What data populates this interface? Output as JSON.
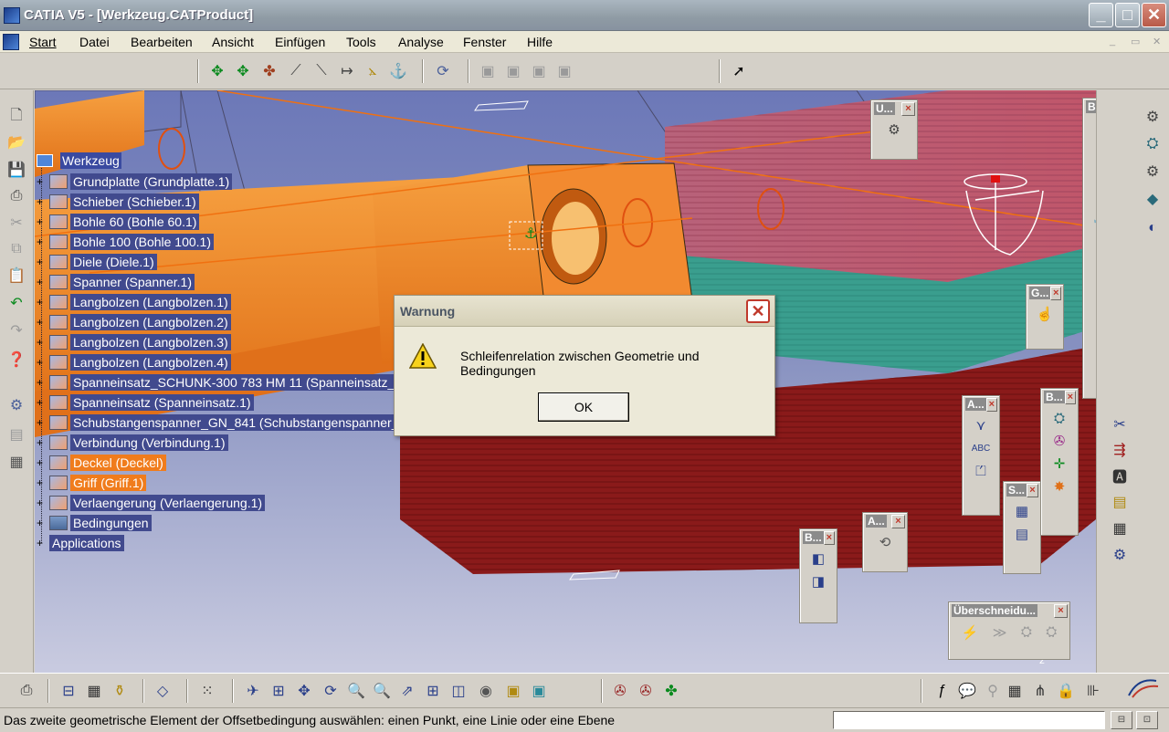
{
  "window": {
    "title": "CATIA V5 - [Werkzeug.CATProduct]",
    "minimize": "_",
    "maximize": "□",
    "close": "✕"
  },
  "menu": {
    "items": [
      {
        "label": "Start"
      },
      {
        "label": "Datei"
      },
      {
        "label": "Bearbeiten"
      },
      {
        "label": "Ansicht"
      },
      {
        "label": "Einfügen"
      },
      {
        "label": "Tools"
      },
      {
        "label": "Analyse"
      },
      {
        "label": "Fenster"
      },
      {
        "label": "Hilfe"
      }
    ],
    "mdi_minimize": "_",
    "mdi_restore": "▭",
    "mdi_close": "✕"
  },
  "tree": {
    "root": "Werkzeug",
    "nodes": [
      {
        "label": "Grundplatte (Grundplatte.1)",
        "state": "normal"
      },
      {
        "label": "Schieber (Schieber.1)",
        "state": "normal"
      },
      {
        "label": "Bohle 60 (Bohle 60.1)",
        "state": "normal"
      },
      {
        "label": "Bohle 100 (Bohle 100.1)",
        "state": "normal"
      },
      {
        "label": "Diele (Diele.1)",
        "state": "normal"
      },
      {
        "label": "Spanner (Spanner.1)",
        "state": "normal"
      },
      {
        "label": "Langbolzen (Langbolzen.1)",
        "state": "normal"
      },
      {
        "label": "Langbolzen (Langbolzen.2)",
        "state": "normal"
      },
      {
        "label": "Langbolzen (Langbolzen.3)",
        "state": "normal"
      },
      {
        "label": "Langbolzen (Langbolzen.4)",
        "state": "normal"
      },
      {
        "label": "Spanneinsatz_SCHUNK-300 783 HM 11 (Spanneinsatz_S",
        "state": "normal"
      },
      {
        "label": "Spanneinsatz (Spanneinsatz.1)",
        "state": "normal"
      },
      {
        "label": "Schubstangenspanner_GN_841 (Schubstangenspanner_",
        "state": "normal"
      },
      {
        "label": "Verbindung (Verbindung.1)",
        "state": "normal"
      },
      {
        "label": "Deckel (Deckel)",
        "state": "selected"
      },
      {
        "label": "Griff (Griff.1)",
        "state": "selected"
      },
      {
        "label": "Verlaengerung (Verlaengerung.1)",
        "state": "normal"
      },
      {
        "label": "Bedingungen",
        "state": "normal"
      },
      {
        "label": "Applications",
        "state": "app"
      }
    ]
  },
  "palettes": {
    "u": {
      "title": "U...",
      "close": "×"
    },
    "b_right": {
      "title": "B...",
      "close": "×"
    },
    "g": {
      "title": "G...",
      "close": "×"
    },
    "a1": {
      "title": "A...",
      "close": "×"
    },
    "b2": {
      "title": "B...",
      "close": "×"
    },
    "s": {
      "title": "S...",
      "close": "×"
    },
    "a2": {
      "title": "A...",
      "close": "×"
    },
    "b3": {
      "title": "B...",
      "close": "×"
    },
    "ueber": {
      "title": "Überschneidu...",
      "close": "×"
    }
  },
  "dialog": {
    "title": "Warnung",
    "message": "Schleifenrelation zwischen Geometrie und Bedingungen",
    "ok_label": "OK",
    "close": "✕"
  },
  "status": {
    "text": "Das zweite geometrische Element der Offsetbedingung auswählen: einen Punkt, eine Linie oder eine Ebene",
    "input_value": ""
  },
  "brand": {
    "logo_text": "CATIA"
  },
  "colors": {
    "accent_selected": "#f07c1c",
    "tree_label_bg": "#414a8e",
    "viewport_top": "#6c78b8",
    "viewport_bottom": "#c9cbe0",
    "dialog_close": "#c0392b"
  }
}
